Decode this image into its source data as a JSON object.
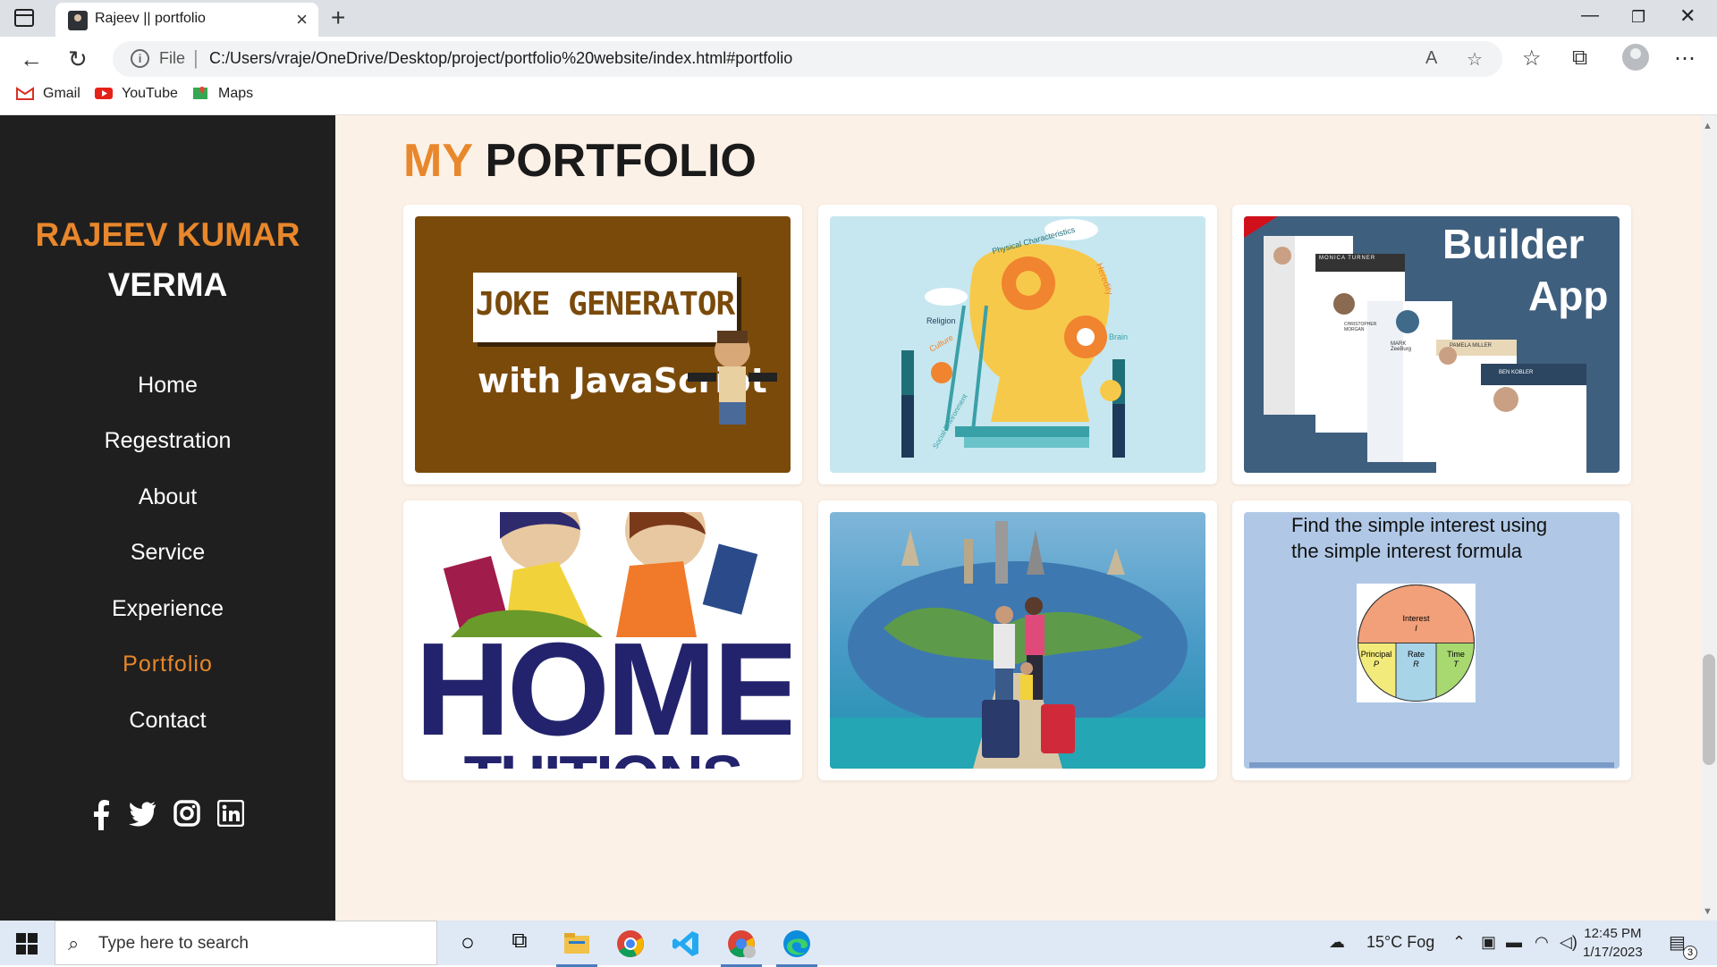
{
  "browser": {
    "tab_title": "Rajeev || portfolio",
    "address_prefix": "File",
    "url": "C:/Users/vraje/OneDrive/Desktop/project/portfolio%20website/index.html#portfolio",
    "bookmarks": [
      {
        "label": "Gmail",
        "icon": "gmail-icon"
      },
      {
        "label": "YouTube",
        "icon": "youtube-icon"
      },
      {
        "label": "Maps",
        "icon": "maps-icon"
      }
    ]
  },
  "sidebar": {
    "name_line1": "RAJEEV KUMAR",
    "name_line2": "VERMA",
    "nav": [
      {
        "label": "Home",
        "active": false
      },
      {
        "label": "Regestration",
        "active": false
      },
      {
        "label": "About",
        "active": false
      },
      {
        "label": "Service",
        "active": false
      },
      {
        "label": "Experience",
        "active": false
      },
      {
        "label": "Portfolio",
        "active": true
      },
      {
        "label": "Contact",
        "active": false
      }
    ],
    "social": [
      "facebook-icon",
      "twitter-icon",
      "instagram-icon",
      "linkedin-icon"
    ]
  },
  "portfolio": {
    "heading_accent": "MY",
    "heading_rest": "PORTFOLIO",
    "cards": [
      {
        "name": "joke-generator",
        "line1": "JOKE GENERATOR",
        "line2": "with JavaScript"
      },
      {
        "name": "brain-gears",
        "words": [
          "Physical Characteristics",
          "Heredity",
          "Religion",
          "Culture",
          "Brain",
          "Social Environment"
        ]
      },
      {
        "name": "resume-builder",
        "line1": "Builder",
        "line2": "App",
        "resume_names": [
          "MONICA TURNER",
          "CHRISTOPHER MORGAN",
          "MARK ZeeBurg",
          "PAMELA MILLER",
          "BEN KOBLER"
        ]
      },
      {
        "name": "home-tuitions",
        "line1": "HOME",
        "line2": "TUITIONS"
      },
      {
        "name": "travel",
        "caption": ""
      },
      {
        "name": "simple-interest",
        "line1": "Find the simple interest using",
        "line2": "the simple interest formula",
        "circle_top": "Interest",
        "circle_top_sym": "I",
        "circle_left": "Principal",
        "circle_left_sym": "P",
        "circle_mid": "Rate",
        "circle_mid_sym": "R",
        "circle_right": "Time",
        "circle_right_sym": "T"
      }
    ]
  },
  "taskbar": {
    "search_placeholder": "Type here to search",
    "weather": "15°C  Fog",
    "time": "12:45 PM",
    "date": "1/17/2023",
    "notification_count": "3"
  },
  "colors": {
    "accent": "#e8872b",
    "sidebar_bg": "#1f1f1f",
    "main_bg": "#fcf1e7"
  }
}
